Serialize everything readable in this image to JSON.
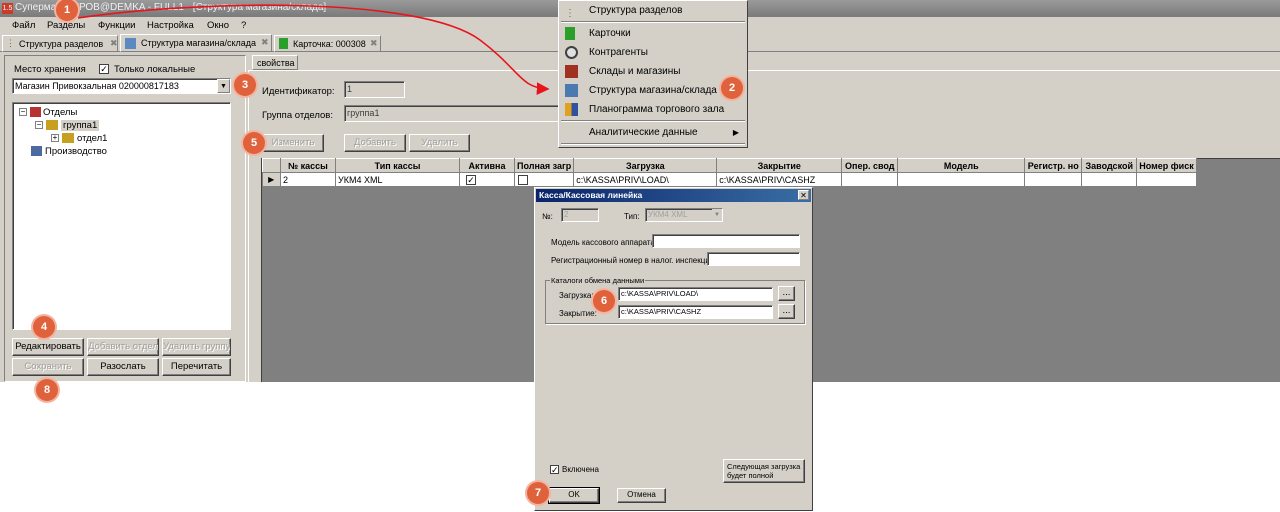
{
  "titlebar": {
    "text": "Суперма    ПЕТРОВ@DEMKA - FULL1 - [Структура магазина/склада]"
  },
  "menubar": {
    "items": [
      "Файл",
      "Разделы",
      "Функции",
      "Настройка",
      "Окно",
      "?"
    ]
  },
  "tabs": [
    {
      "label": "Структура разделов"
    },
    {
      "label": "Структура магазина/склада"
    },
    {
      "label": "Карточка: 000308"
    }
  ],
  "left": {
    "storage_label": "Место хранения",
    "only_local_label": "Только локальные",
    "only_local_checked": true,
    "storage_value": "Магазин Привокзальная 020000817183",
    "tree": [
      {
        "label": "Отделы",
        "level": 0
      },
      {
        "label": "группа1",
        "level": 1
      },
      {
        "label": "отдел1",
        "level": 2
      },
      {
        "label": "Производство",
        "level": 0
      }
    ],
    "buttons": {
      "edit": "Редактировать",
      "add_dept": "Добавить отдел",
      "del_group": "Удалить группу",
      "save": "Сохранить",
      "send": "Разослать",
      "recalc": "Перечитать"
    }
  },
  "right": {
    "tab_label": "свойства",
    "id_label": "Идентификатор:",
    "id_value": "1",
    "group_label": "Группа отделов:",
    "group_value": "группа1",
    "btn_change": "Изменить",
    "btn_add": "Добавить",
    "btn_delete": "Удалить",
    "table": {
      "columns": [
        "№ кассы",
        "Тип кассы",
        "Активна",
        "Полная загр",
        "Загрузка",
        "Закрытие",
        "Опер. свод",
        "Модель",
        "Регистр. но",
        "Заводской",
        "Номер фиск"
      ],
      "rows": [
        {
          "num": "2",
          "type": "УКМ4 XML",
          "active": "✓",
          "full": "",
          "load": "c:\\KASSA\\PRIV\\LOAD\\",
          "close": "c:\\KASSA\\PRIV\\CASHZ"
        }
      ]
    }
  },
  "menu": {
    "items": [
      {
        "label": "Структура разделов",
        "icon": "tree-icon"
      },
      {
        "label": "Карточки",
        "icon": "cards-icon"
      },
      {
        "label": "Контрагенты",
        "icon": "contractors-icon"
      },
      {
        "label": "Склады и магазины",
        "icon": "warehouse-icon"
      },
      {
        "label": "Структура магазина/склада",
        "icon": "store-structure-icon"
      },
      {
        "label": "Планограмма торгового зала",
        "icon": "planogram-icon"
      },
      {
        "label": "Аналитические данные",
        "icon": "chevron-right-icon"
      }
    ]
  },
  "dialog": {
    "title": "Касса/Кассовая линейка",
    "num_label": "№:",
    "num_value": "2",
    "type_label": "Тип:",
    "type_value": "УКМ4 XML",
    "model_label": "Модель кассового аппарата:",
    "model_value": "",
    "reg_label": "Регистрационный номер в налог. инспекции:",
    "reg_value": "",
    "catalogs_label": "Каталоги обмена данными",
    "load_label": "Загрузка:",
    "load_value": "c:\\KASSA\\PRIV\\LOAD\\",
    "close_label": "Закрытие:",
    "close_value": "c:\\KASSA\\PRIV\\CASHZ",
    "browse": "...",
    "enabled_label": "Включена",
    "enabled_checked": true,
    "next_full_label": "Следующая загрузка будет полной",
    "ok": "OK",
    "cancel": "Отмена"
  },
  "badges": [
    "1",
    "2",
    "3",
    "4",
    "5",
    "6",
    "7",
    "8"
  ],
  "colors": {
    "badge": "#e0623c",
    "arrow": "#e8141c",
    "titlebar": "#808080",
    "face": "#d4d0c8"
  }
}
